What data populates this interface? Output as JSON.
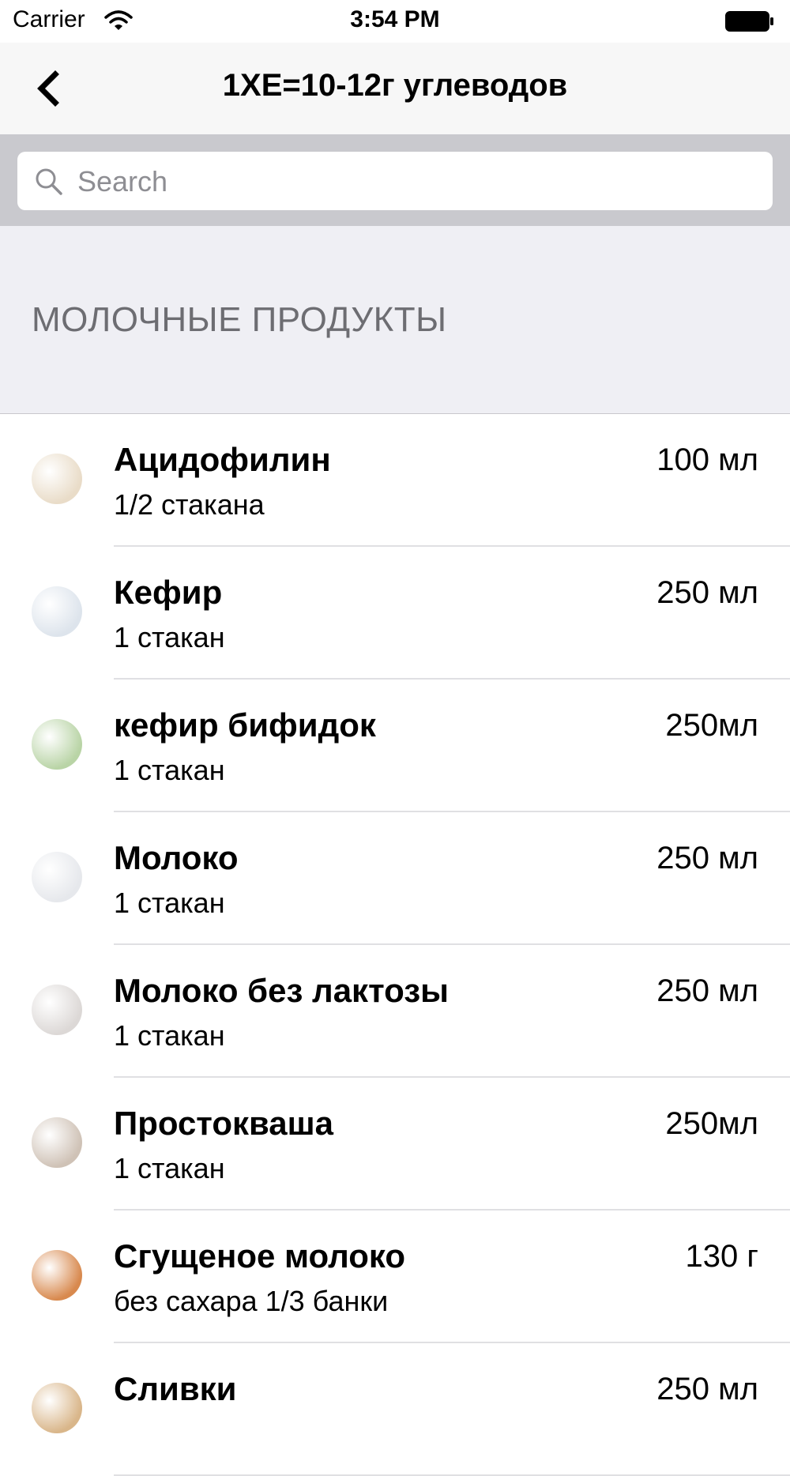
{
  "status_bar": {
    "carrier": "Carrier",
    "time": "3:54 PM"
  },
  "nav": {
    "title": "1ХЕ=10-12г углеводов"
  },
  "search": {
    "placeholder": "Search"
  },
  "section": {
    "title": "МОЛОЧНЫЕ ПРОДУКТЫ"
  },
  "items": [
    {
      "name": "Ацидофилин",
      "portion": "1/2 стакана",
      "amount": "100 мл",
      "thumb_color": "#e9dcc8"
    },
    {
      "name": "Кефир",
      "portion": "1 стакан",
      "amount": "250 мл",
      "thumb_color": "#dde4ec"
    },
    {
      "name": "кефир бифидок",
      "portion": "1 стакан",
      "amount": "250мл",
      "thumb_color": "#b9d4a6"
    },
    {
      "name": "Молоко",
      "portion": "1 стакан",
      "amount": "250 мл",
      "thumb_color": "#e6e8ec"
    },
    {
      "name": "Молоко без лактозы",
      "portion": "1 стакан",
      "amount": "250 мл",
      "thumb_color": "#dcd8d6"
    },
    {
      "name": "Простокваша",
      "portion": "1 стакан",
      "amount": "250мл",
      "thumb_color": "#cfc2b6"
    },
    {
      "name": "Сгущеное молоко",
      "portion": "без сахара 1/3 банки",
      "amount": "130 г",
      "thumb_color": "#d8894e"
    },
    {
      "name": "Сливки",
      "portion": "",
      "amount": "250 мл",
      "thumb_color": "#d9b68a"
    }
  ]
}
